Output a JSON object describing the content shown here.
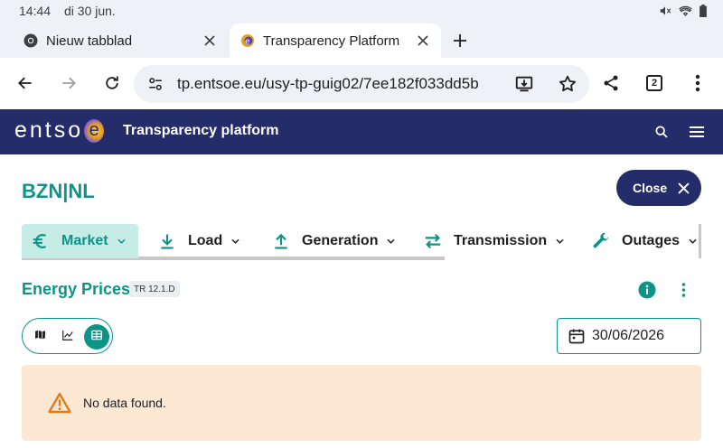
{
  "status_bar": {
    "time": "14:44",
    "date": "di 30 jun.",
    "icons": [
      "mute-icon",
      "wifi-icon",
      "battery-icon"
    ]
  },
  "tabs": [
    {
      "title": "Nieuw tabblad",
      "favicon": "chrome-icon",
      "active": false
    },
    {
      "title": "Transparency Platform",
      "favicon": "entsoe-favicon",
      "active": true
    }
  ],
  "toolbar": {
    "url": "tp.entsoe.eu/usy-tp-guig02/7ee182f033dd5b",
    "tab_count": "2"
  },
  "header": {
    "logo_text": "entso",
    "logo_e": "e",
    "title": "Transparency platform"
  },
  "zone": {
    "title": "BZN|NL",
    "close_label": "Close"
  },
  "categories": [
    {
      "label": "Market",
      "icon": "euro-icon",
      "active": true
    },
    {
      "label": "Load",
      "icon": "download-icon",
      "active": false
    },
    {
      "label": "Generation",
      "icon": "upload-icon",
      "active": false
    },
    {
      "label": "Transmission",
      "icon": "swap-icon",
      "active": false
    },
    {
      "label": "Outages",
      "icon": "wrench-icon",
      "active": false
    }
  ],
  "section": {
    "title": "Energy Prices",
    "badge": "TR 12.1.D"
  },
  "view_toggle": {
    "options": [
      "map-icon",
      "chart-icon",
      "table-icon"
    ],
    "selected": "table-icon"
  },
  "date_picker": {
    "value": "30/06/2026"
  },
  "alert": {
    "message": "No data found."
  },
  "colors": {
    "brand_navy": "#242c6a",
    "accent_teal": "#0d9488",
    "active_tab_bg": "#c6ece6",
    "alert_bg": "#fde8d4",
    "warning": "#e07b1a"
  }
}
